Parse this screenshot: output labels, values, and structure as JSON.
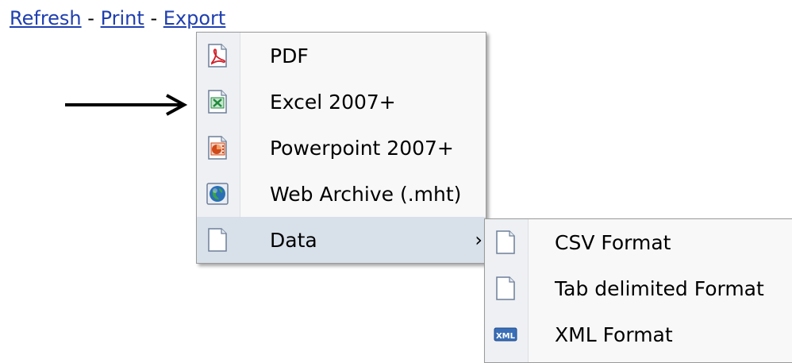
{
  "toolbar": {
    "refresh": "Refresh",
    "print": "Print",
    "export": "Export",
    "separator": "-"
  },
  "export_menu": {
    "items": [
      {
        "label": "PDF",
        "icon": "pdf-icon"
      },
      {
        "label": "Excel 2007+",
        "icon": "excel-icon"
      },
      {
        "label": "Powerpoint 2007+",
        "icon": "powerpoint-icon"
      },
      {
        "label": "Web Archive (.mht)",
        "icon": "web-archive-icon"
      },
      {
        "label": "Data",
        "icon": "document-icon",
        "submenu_indicator": "›"
      }
    ]
  },
  "data_submenu": {
    "items": [
      {
        "label": "CSV Format",
        "icon": "document-icon"
      },
      {
        "label": "Tab delimited Format",
        "icon": "document-icon"
      },
      {
        "label": "XML Format",
        "icon": "xml-icon",
        "icon_text": "XML"
      }
    ]
  },
  "colors": {
    "link": "#1f3fb0",
    "hover": "#d8e0ea",
    "pdf": "#d0202a",
    "excel": "#1e8a3c",
    "powerpoint": "#d04a1a",
    "web": "#2a6fb5"
  }
}
